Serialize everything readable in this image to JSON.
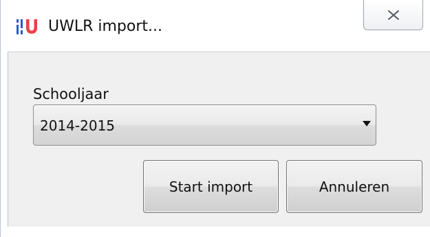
{
  "window": {
    "title": "UWLR import...",
    "app_icon": "uu-logo-icon",
    "close_icon": "close-icon"
  },
  "form": {
    "year_label": "Schooljaar",
    "year_select": {
      "value": "2014-2015",
      "arrow_icon": "dropdown-arrow-icon"
    }
  },
  "buttons": {
    "start_label": "Start import",
    "cancel_label": "Annuleren"
  },
  "colors": {
    "logo_blue": "#2b59c3",
    "logo_red": "#e8424a",
    "content_bg": "#f0f0f0"
  }
}
